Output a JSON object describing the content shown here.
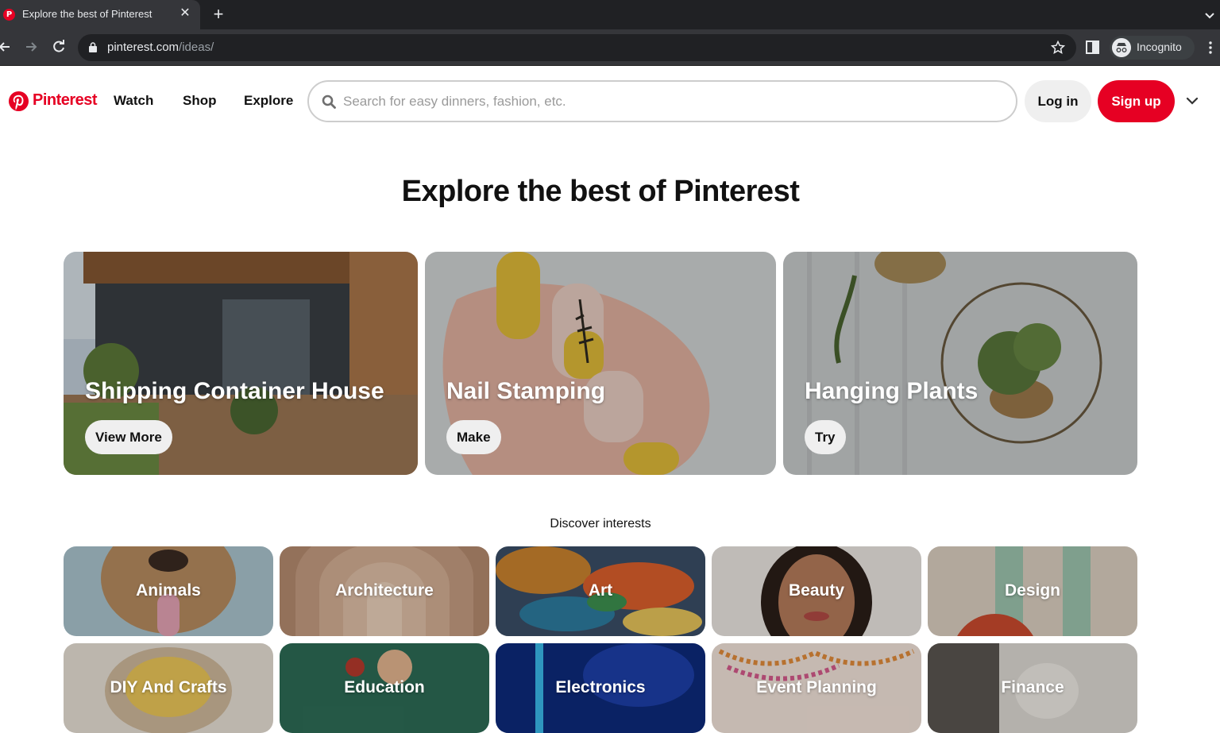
{
  "browser": {
    "tab_title": "Explore the best of Pinterest",
    "url_host": "pinterest.com",
    "url_path": "/ideas/",
    "profile_label": "Incognito"
  },
  "header": {
    "brand": "Pinterest",
    "nav": [
      "Watch",
      "Shop",
      "Explore"
    ],
    "search_placeholder": "Search for easy dinners, fashion, etc.",
    "login_label": "Log in",
    "signup_label": "Sign up"
  },
  "page_title": "Explore the best of Pinterest",
  "featured": [
    {
      "title": "Shipping Container House",
      "button": "View More"
    },
    {
      "title": "Nail Stamping",
      "button": "Make"
    },
    {
      "title": "Hanging Plants",
      "button": "Try"
    }
  ],
  "discover_label": "Discover interests",
  "interests_row1": [
    "Animals",
    "Architecture",
    "Art",
    "Beauty",
    "Design"
  ],
  "interests_row2": [
    "DIY And Crafts",
    "Education",
    "Electronics",
    "Event Planning",
    "Finance"
  ],
  "colors": {
    "brand_red": "#e60023",
    "chrome_dark": "#202124",
    "chrome_toolbar": "#35363a"
  }
}
